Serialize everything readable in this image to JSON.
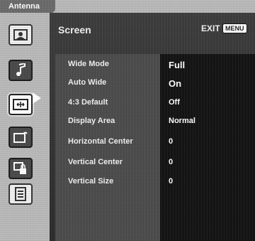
{
  "top_tab": {
    "label": "Antenna"
  },
  "panel": {
    "title": "Screen",
    "exit_label": "EXIT",
    "menu_key": "MENU"
  },
  "sidebar": {
    "items": [
      {
        "name": "picture-icon"
      },
      {
        "name": "sound-icon"
      },
      {
        "name": "screen-icon"
      },
      {
        "name": "setup-icon"
      },
      {
        "name": "lock-icon"
      },
      {
        "name": "menu-list-icon"
      }
    ]
  },
  "settings": [
    {
      "label": "Wide Mode",
      "value": "Full"
    },
    {
      "label": "Auto Wide",
      "value": "On"
    },
    {
      "label": "4:3 Default",
      "value": "Off"
    },
    {
      "label": "Display Area",
      "value": "Normal"
    },
    {
      "label": "Horizontal Center",
      "value": "0"
    },
    {
      "label": "Vertical Center",
      "value": "0"
    },
    {
      "label": "Vertical Size",
      "value": "0"
    }
  ]
}
